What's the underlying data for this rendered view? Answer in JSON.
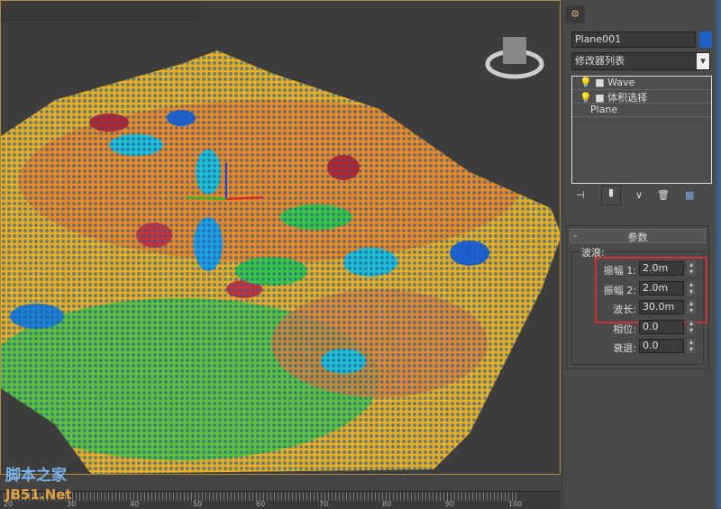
{
  "panel": {
    "object_name": "Plane001",
    "object_color": "#1f5fc8",
    "modifier_list": "修改器列表",
    "stack": [
      {
        "label": "Wave"
      },
      {
        "label": "体积选择"
      },
      {
        "label": "Plane"
      }
    ],
    "rollout_title": "参数",
    "group_title": "波浪:",
    "params": [
      {
        "label": "振幅 1:",
        "value": "2.0m"
      },
      {
        "label": "振幅 2:",
        "value": "2.0m"
      },
      {
        "label": "波长:",
        "value": "30.0m"
      },
      {
        "label": "相位:",
        "value": "0.0"
      },
      {
        "label": "衰退:",
        "value": "0.0"
      }
    ],
    "highlight_color": "#d03030"
  },
  "timeline": {
    "labels": [
      "20",
      "30",
      "40",
      "50",
      "60",
      "70",
      "80",
      "90",
      "100"
    ]
  },
  "watermark": {
    "line1": "脚本之家",
    "line2": "JB51.Net"
  }
}
